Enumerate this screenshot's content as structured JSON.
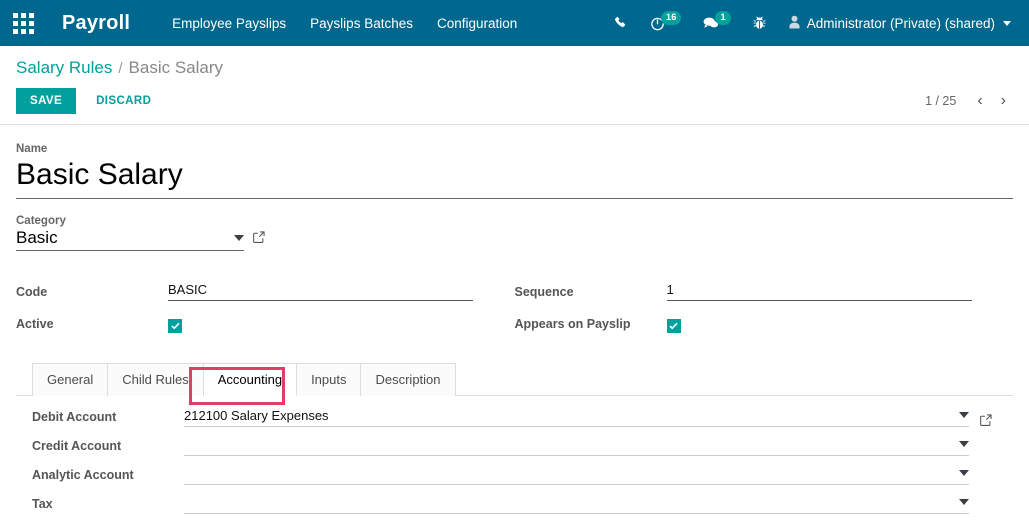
{
  "navbar": {
    "apps_icon": "apps-grid-icon",
    "brand": "Payroll",
    "menu": [
      {
        "label": "Employee Payslips"
      },
      {
        "label": "Payslips Batches"
      },
      {
        "label": "Configuration"
      }
    ],
    "icons": [
      {
        "name": "phone-icon",
        "badge": null
      },
      {
        "name": "activity-clock-icon",
        "badge": "16"
      },
      {
        "name": "messages-icon",
        "badge": "1"
      },
      {
        "name": "debug-bug-icon",
        "badge": null
      }
    ],
    "user": {
      "avatar_icon": "user-avatar-icon",
      "label": "Administrator (Private) (shared)"
    },
    "bg_color": "#00688e"
  },
  "control_panel": {
    "breadcrumb": {
      "parent": "Salary Rules",
      "separator": "/",
      "current": "Basic Salary"
    },
    "save_label": "SAVE",
    "discard_label": "DISCARD",
    "save_color": "#00a09d",
    "pager": {
      "count": "1 / 25",
      "prev_icon": "chevron-left-icon",
      "next_icon": "chevron-right-icon"
    }
  },
  "form": {
    "name": {
      "label": "Name",
      "value": "Basic Salary"
    },
    "category": {
      "label": "Category",
      "value": "Basic",
      "dropdown_icon": "chevron-down-icon",
      "external_icon": "external-link-icon"
    },
    "code": {
      "label": "Code",
      "value": "BASIC"
    },
    "sequence": {
      "label": "Sequence",
      "value": "1"
    },
    "active": {
      "label": "Active",
      "checked": true
    },
    "appears_on_payslip": {
      "label": "Appears on Payslip",
      "checked": true
    }
  },
  "notebook": {
    "tabs": [
      {
        "label": "General",
        "active": false
      },
      {
        "label": "Child Rules",
        "active": false
      },
      {
        "label": "Accounting",
        "active": true
      },
      {
        "label": "Inputs",
        "active": false
      },
      {
        "label": "Description",
        "active": false
      }
    ],
    "highlight": {
      "target": "Accounting",
      "color": "#e23d65"
    }
  },
  "accounting": {
    "rows": [
      {
        "label": "Debit Account",
        "value": "212100 Salary Expenses",
        "placeholder": "",
        "has_external": true
      },
      {
        "label": "Credit Account",
        "value": "",
        "placeholder": "",
        "has_external": false
      },
      {
        "label": "Analytic Account",
        "value": "",
        "placeholder": "",
        "has_external": false
      },
      {
        "label": "Tax",
        "value": "",
        "placeholder": "",
        "has_external": false
      }
    ]
  }
}
